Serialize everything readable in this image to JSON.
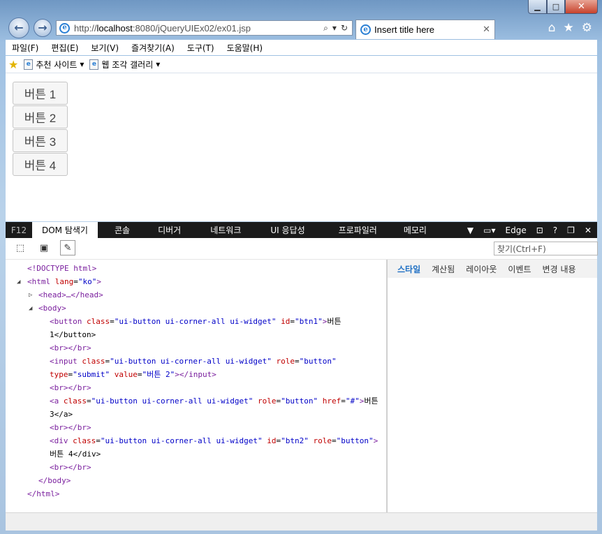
{
  "browser": {
    "url_prefix": "http://",
    "url_host": "localhost",
    "url_rest": ":8080/jQueryUIEx02/ex01.jsp",
    "tab_title": "Insert title here",
    "menu": [
      "파일(F)",
      "편집(E)",
      "보기(V)",
      "즐겨찾기(A)",
      "도구(T)",
      "도움말(H)"
    ],
    "favorites": [
      {
        "label": "추천 사이트"
      },
      {
        "label": "웹 조각 갤러리"
      }
    ]
  },
  "page": {
    "buttons": [
      "버튼 1",
      "버튼 2",
      "버튼 3",
      "버튼 4"
    ]
  },
  "devtools": {
    "f12": "F12",
    "tabs": [
      "DOM 탐색기",
      "콘솔",
      "디버거",
      "네트워크",
      "UI 응답성",
      "프로파일러",
      "메모리"
    ],
    "mode": "Edge",
    "search_placeholder": "찾기(Ctrl+F)",
    "side_tabs": [
      "스타일",
      "계산됨",
      "레이아웃",
      "이벤트",
      "변경 내용"
    ],
    "dom": {
      "doctype": "<!DOCTYPE html>",
      "html_open_tag": "<html",
      "html_attr": "lang",
      "html_val": "\"ko\"",
      "head": "<head>…</head>",
      "body_open": "<body>",
      "btn1_a": "<button",
      "btn1_class_val": "\"ui-button ui-corner-all ui-widget\"",
      "btn1_id_val": "\"btn1\"",
      "btn1_text": "버튼",
      "btn1_text2": "1</button>",
      "br": "<br></br>",
      "input_a": "<input",
      "input_class_val": "\"ui-button ui-corner-all ui-widget\"",
      "input_role_val": "\"button\"",
      "input_type_val": "\"submit\"",
      "input_value_val": "\"버튼 2\"",
      "input_close": "></input>",
      "a_a": "<a",
      "a_class_val": "\"ui-button ui-corner-all ui-widget\"",
      "a_role_val": "\"button\"",
      "a_href_val": "\"#\"",
      "a_text": "버튼",
      "a_text2": "3</a>",
      "div_a": "<div",
      "div_class_val": "\"ui-button ui-corner-all ui-widget\"",
      "div_id_val": "\"btn2\"",
      "div_role_val": "\"button\"",
      "div_text": "버튼 4</div>",
      "body_close": "</body>",
      "html_close": "</html>",
      "attr_class": "class",
      "attr_id": "id",
      "attr_role": "role",
      "attr_type": "type",
      "attr_value": "value",
      "attr_href": "href"
    }
  }
}
